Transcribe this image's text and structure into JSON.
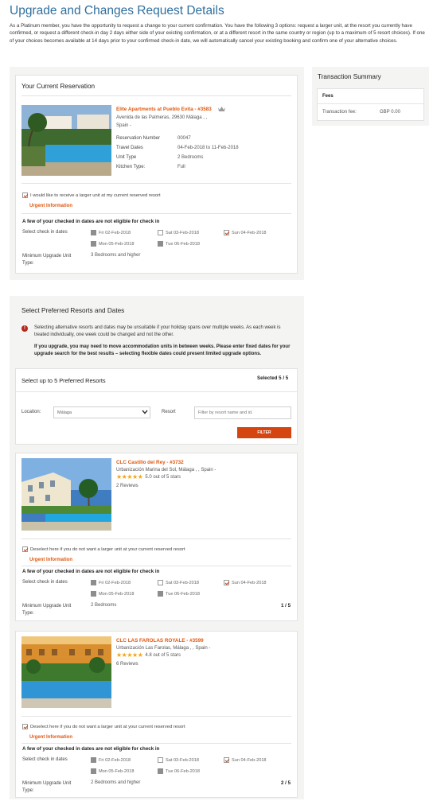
{
  "page": {
    "title": "Upgrade and Changes Request Details",
    "intro": "As a Platinum member, you have the opportunity to request a change to your current confirmation.  You have the following 3 options: request a larger unit, at the resort you currently have confirmed, or request a different check-in day 2 days either side of your existing confirmation, or at a different resort in the same country or region (up to a maximum of 5 resort choices).  If one of your choices becomes available at 14 days prior to your confirmed check-in date, we will automatically  cancel your existing booking and confirm one of your alternative choices."
  },
  "current": {
    "heading": "Your Current Reservation",
    "resort_name": "Elite Apartments at Pueblo Evita - #3583",
    "address_line1": "Avenida de las Palmeras, 29630 Málaga ,  ,",
    "address_line2": "Spain  -",
    "rows": [
      {
        "label": "Reservation Number",
        "value": "00047"
      },
      {
        "label": "Travel Dates",
        "value": "04-Feb-2018 to 11-Feb-2018"
      },
      {
        "label": "Unit Type",
        "value": "2 Bedrooms"
      },
      {
        "label": "Kitchen Type:",
        "value": "Full"
      }
    ],
    "larger_unit_label": "I would like to receive a larger unit at my current reserved resort",
    "urgent": "Urgent Information",
    "not_eligible": "A few of your checked in dates are not eligible for check in",
    "select_dates_label": "Select check in dates",
    "dates": [
      "Fri 02-Feb-2018",
      "Sat 03-Feb-2018",
      "Sun 04-Feb-2018",
      "Mon 05-Feb-2018",
      "Tue 06-Feb-2018"
    ],
    "min_upgrade_label": "Minimum Upgrade Unit Type:",
    "min_upgrade_value": "3 Bedrooms and higher"
  },
  "transaction": {
    "heading": "Transaction Summary",
    "fees_label": "Fees",
    "fee_label": "Transaction fee:",
    "fee_value": "GBP 0.00"
  },
  "preferred": {
    "heading": "Select Preferred Resorts and Dates",
    "warning1": "Selecting alternative resorts and dates may be unsuitable if your holiday spans over multiple weeks. As each week is treated individually, one week could be changed and not the other.",
    "warning2": "If you upgrade, you may need to move accommodation units in between weeks.  Please enter fixed dates for your upgrade search for the best results – selecting flexible dates could present limited upgrade options.",
    "select_heading": "Select up to 5 Preferred Resorts",
    "selected_count": "Selected 5 / 5",
    "location_label": "Location:",
    "location_value": "Málaga",
    "resort_label": "Resort",
    "resort_placeholder": "Filter by resort name and id.",
    "filter_button": "FILTER"
  },
  "resorts": [
    {
      "name": "CLC Castillo del Rey - #3732",
      "address": "Urbanización Marina del Sol, Málaga ,  ,  Spain  -",
      "rating": "5.0 out of 5 stars",
      "reviews": "2 Reviews",
      "deselect": "Deselect here if you do not want a larger unit at your current reserved resort",
      "urgent": "Urgent Information",
      "not_eligible": "A few of your checked in dates are not eligible for check in",
      "select_dates_label": "Select check in dates",
      "dates": [
        "Fri 02-Feb-2018",
        "Sat 03-Feb-2018",
        "Sun 04-Feb-2018",
        "Mon 05-Feb-2018",
        "Tue 06-Feb-2018"
      ],
      "min_upgrade_label": "Minimum Upgrade Unit Type:",
      "min_upgrade_value": "2 Bedrooms",
      "index": "1 / 5"
    },
    {
      "name": "CLC LAS FAROLAS ROYALE - #3599",
      "address": "Urbanización Las Farolas, Málaga ,  ,  Spain  -",
      "rating": "4.8 out of 5 stars",
      "reviews": "6 Reviews",
      "deselect": "Deselect here if you do not want a larger unit at your current reserved resort",
      "urgent": "Urgent Information",
      "not_eligible": "A few of your checked in dates are not eligible for check in",
      "select_dates_label": "Select check in dates",
      "dates": [
        "Fri 02-Feb-2018",
        "Sat 03-Feb-2018",
        "Sun 04-Feb-2018",
        "Mon 05-Feb-2018",
        "Tue 06-Feb-2018"
      ],
      "min_upgrade_label": "Minimum Upgrade Unit Type:",
      "min_upgrade_value": "2 Bedrooms and higher",
      "index": "2 / 5"
    }
  ],
  "colors": {
    "accent": "#e0570f",
    "title": "#2f6f9e",
    "button": "#d44512",
    "star": "#f2a516"
  }
}
